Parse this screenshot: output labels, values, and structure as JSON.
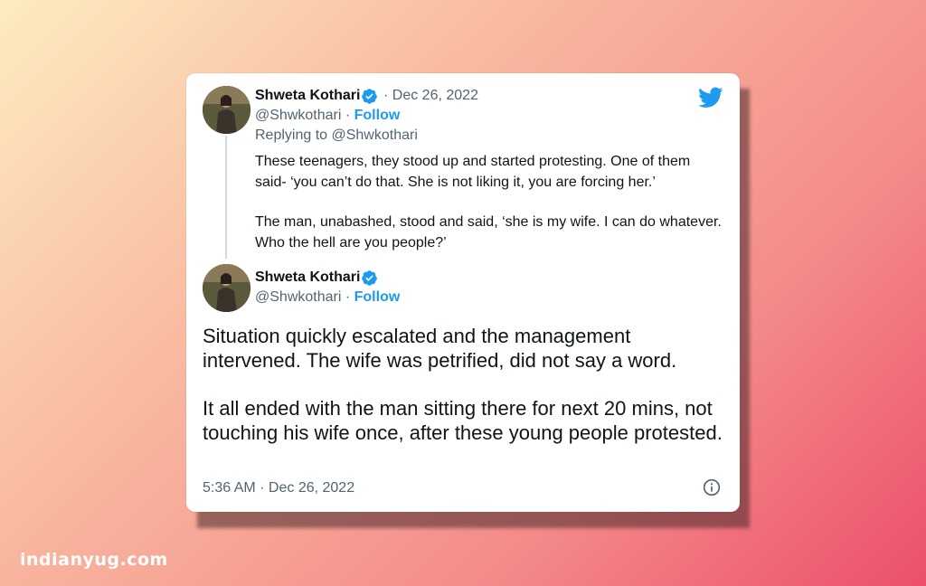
{
  "tweet_reply": {
    "author_name": "Shweta Kothari",
    "date": "Dec 26, 2022",
    "handle": "@Shwkothari",
    "follow_label": "Follow",
    "replying_to": "Replying to @Shwkothari",
    "paragraphs": [
      "These teenagers, they stood up and started protesting. One of them said- ‘you can’t do that. She is not liking it, you are forcing her.’",
      "The man, unabashed, stood and said, ‘she is my wife. I can do whatever. Who the hell are you people?’"
    ]
  },
  "tweet_main": {
    "author_name": "Shweta Kothari",
    "handle": "@Shwkothari",
    "follow_label": "Follow",
    "paragraphs": [
      "Situation quickly escalated and the management intervened. The wife was petrified, did not say a word.",
      "It all ended with the man sitting there for next 20 mins, not touching his wife once, after these young people protested."
    ],
    "timestamp": "5:36 AM · Dec 26, 2022"
  },
  "icons": {
    "brand": "twitter-bird-icon",
    "verified": "verified-badge-icon",
    "info": "info-icon"
  },
  "colors": {
    "twitter_blue": "#1d9bf0",
    "text": "#0f1419",
    "muted": "#536471"
  },
  "watermark": "indianyug.com"
}
